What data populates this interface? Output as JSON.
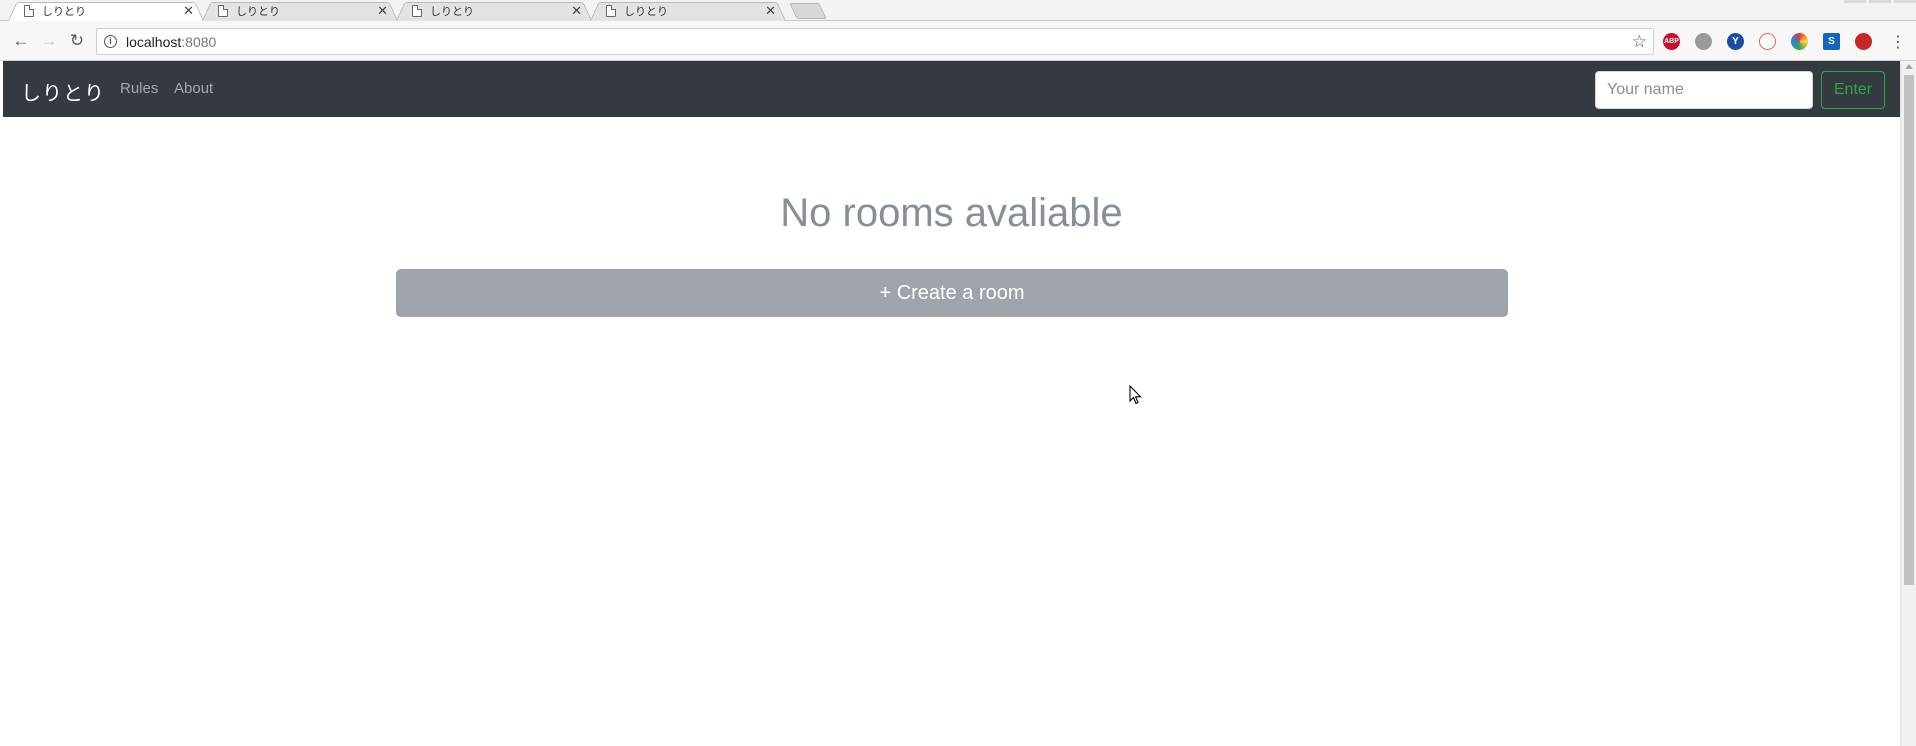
{
  "browser": {
    "tabs": [
      {
        "title": "しりとり",
        "active": true
      },
      {
        "title": "しりとり",
        "active": false
      },
      {
        "title": "しりとり",
        "active": false
      },
      {
        "title": "しりとり",
        "active": false
      }
    ],
    "address": {
      "host": "localhost",
      "port": ":8080"
    },
    "extensions": [
      {
        "name": "adblock-icon",
        "label": "ABP",
        "color": "#c8102e"
      },
      {
        "name": "extension-ghost-icon",
        "label": "",
        "color": "#9a9a9a"
      },
      {
        "name": "extension-y-icon",
        "label": "Y",
        "color": "#1a4ea0"
      },
      {
        "name": "extension-translate-icon",
        "label": "",
        "color": "#e06a5b"
      },
      {
        "name": "extension-color-icon",
        "label": "",
        "color": "#2e7d32"
      },
      {
        "name": "extension-s-icon",
        "label": "S",
        "color": "#1565c0"
      },
      {
        "name": "extension-cat-icon",
        "label": "",
        "color": "#c62828"
      }
    ]
  },
  "navbar": {
    "brand": "しりとり",
    "links": [
      "Rules",
      "About"
    ],
    "name_placeholder": "Your name",
    "enter_label": "Enter"
  },
  "main": {
    "heading": "No rooms avaliable",
    "create_label": "+ Create a room"
  },
  "colors": {
    "navbar_bg": "#343a40",
    "heading": "#868e96",
    "create_button": "#9fa4aa",
    "enter_button": "#28a745"
  }
}
